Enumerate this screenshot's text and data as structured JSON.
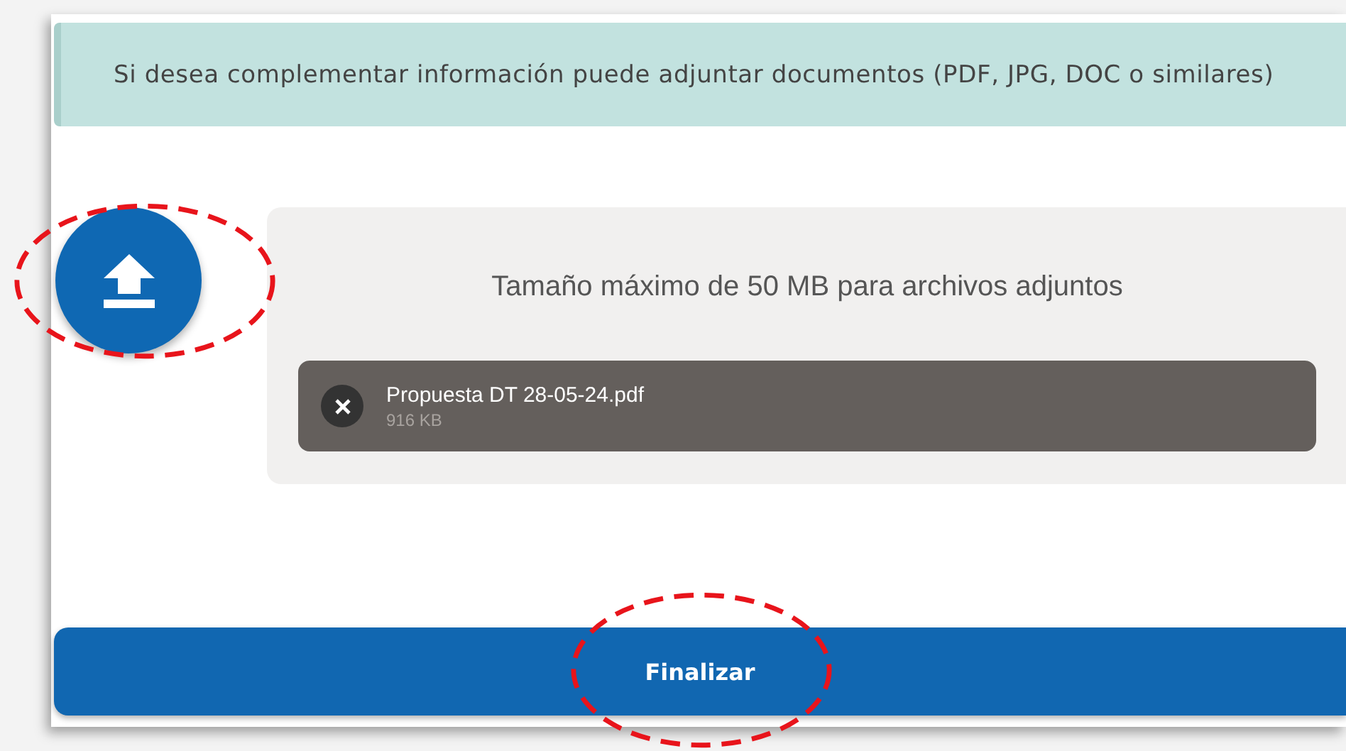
{
  "info_text": "Si desea complementar información puede adjuntar documentos (PDF, JPG, DOC o similares)",
  "upload_button": {
    "highlighted": true
  },
  "dropzone": {
    "note": "Tamaño máximo de 50 MB para archivos adjuntos"
  },
  "files": [
    {
      "name": "Propuesta DT 28-05-24.pdf",
      "size": "916 KB"
    }
  ],
  "finish_button": {
    "label": "Finalizar",
    "highlighted": true
  }
}
